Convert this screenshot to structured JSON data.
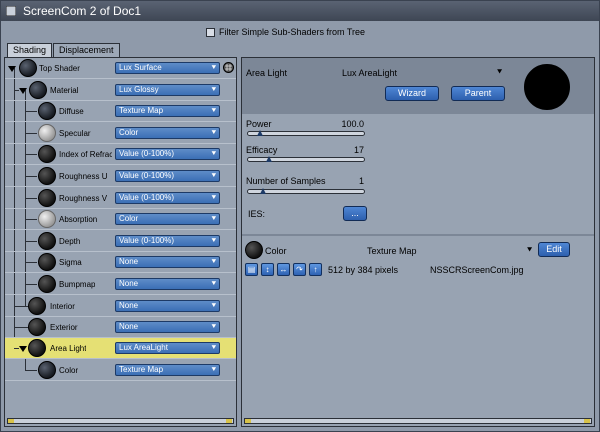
{
  "window": {
    "title": "ScreenCom 2 of Doc1"
  },
  "filter": {
    "label": "Filter Simple Sub-Shaders from Tree",
    "checked": false
  },
  "tabs": [
    {
      "label": "Shading",
      "active": true
    },
    {
      "label": "Displacement",
      "active": false
    }
  ],
  "tree": {
    "rows": [
      {
        "label": "Top Shader",
        "value": "Lux Surface"
      },
      {
        "label": "Material",
        "value": "Lux Glossy"
      },
      {
        "label": "Diffuse",
        "value": "Texture Map"
      },
      {
        "label": "Specular",
        "value": "Color"
      },
      {
        "label": "Index of Refraction",
        "value": "Value (0-100%)"
      },
      {
        "label": "Roughness U",
        "value": "Value (0-100%)"
      },
      {
        "label": "Roughness V",
        "value": "Value (0-100%)"
      },
      {
        "label": "Absorption",
        "value": "Color"
      },
      {
        "label": "Depth",
        "value": "Value (0-100%)"
      },
      {
        "label": "Sigma",
        "value": "None"
      },
      {
        "label": "Bumpmap",
        "value": "None"
      },
      {
        "label": "Interior",
        "value": "None"
      },
      {
        "label": "Exterior",
        "value": "None"
      },
      {
        "label": "Area Light",
        "value": "Lux AreaLight"
      },
      {
        "label": "Color",
        "value": "Texture Map"
      }
    ]
  },
  "panel": {
    "title": "Area Light",
    "type": "Lux AreaLight",
    "wizard_label": "Wizard",
    "parent_label": "Parent",
    "power_label": "Power",
    "power_value": "100.0",
    "efficacy_label": "Efficacy",
    "efficacy_value": "17",
    "samples_label": "Number of Samples",
    "samples_value": "1",
    "ies_label": "IES:",
    "ies_button": "...",
    "color_label": "Color",
    "color_type": "Texture Map",
    "edit_label": "Edit",
    "texture_size": "512 by 384 pixels",
    "texture_file": "NSSCRScreenCom.jpg"
  },
  "sliders": {
    "power": 0.1,
    "efficacy": 0.18,
    "samples": 0.13
  }
}
